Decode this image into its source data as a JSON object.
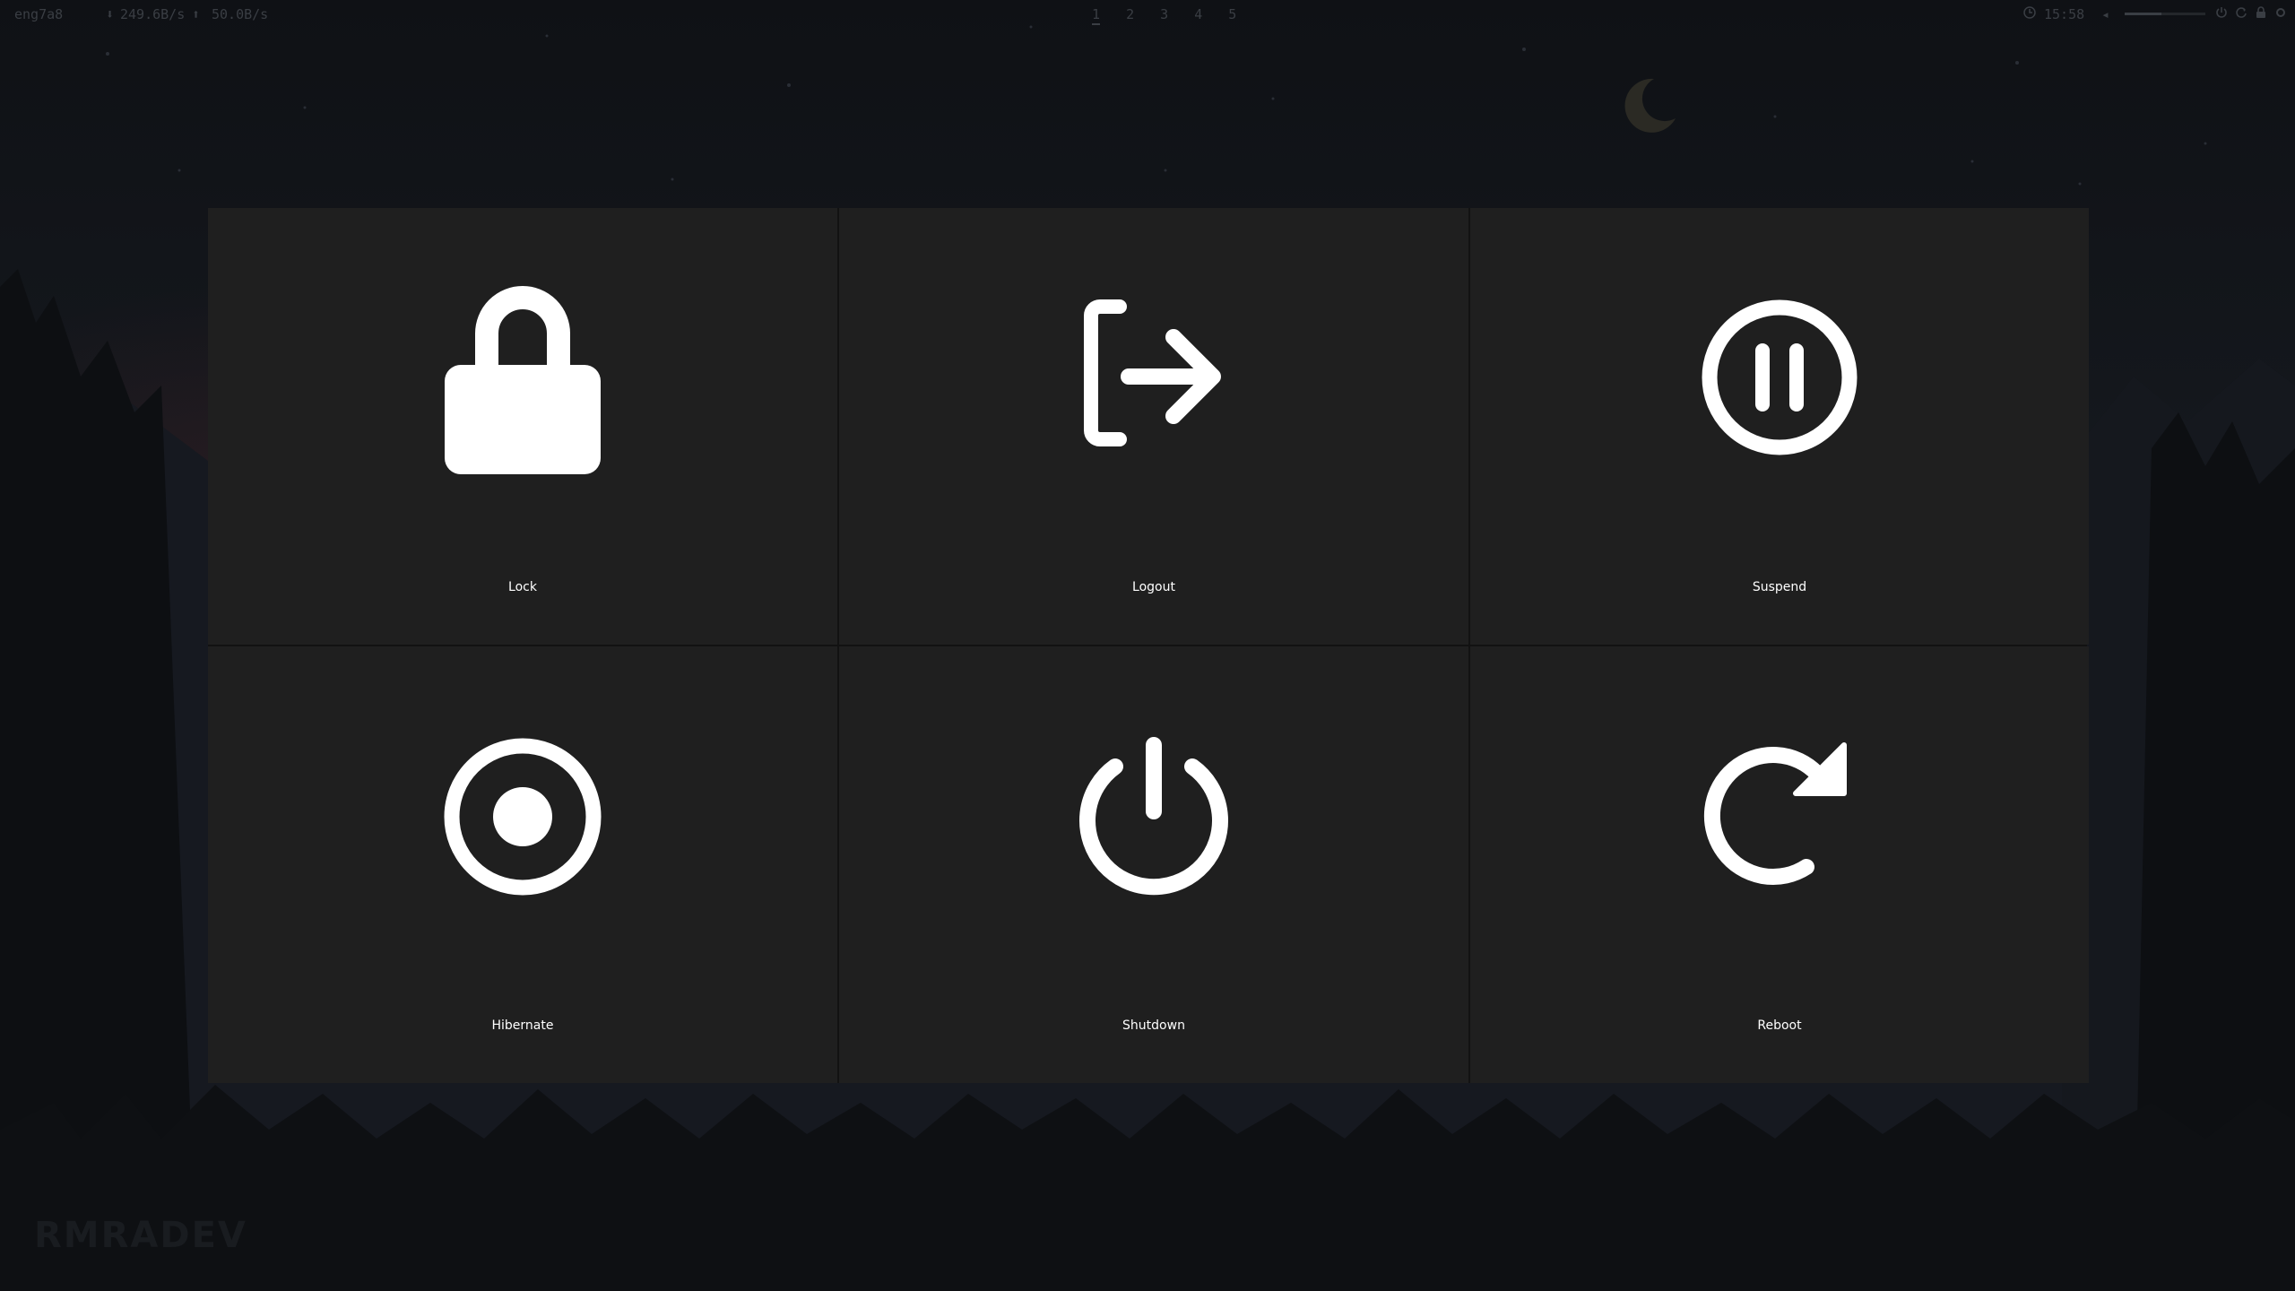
{
  "topbar": {
    "hostname": "eng7a8",
    "net_down": "249.6B/s",
    "net_up": "50.0B/s",
    "workspaces": [
      "1",
      "2",
      "3",
      "4",
      "5"
    ],
    "active_workspace": "1",
    "clock": "15:58",
    "volume_level": 0.45
  },
  "menu": {
    "tiles": [
      {
        "label": "Lock",
        "icon": "lock-icon"
      },
      {
        "label": "Logout",
        "icon": "logout-icon"
      },
      {
        "label": "Suspend",
        "icon": "suspend-icon"
      },
      {
        "label": "Hibernate",
        "icon": "hibernate-icon"
      },
      {
        "label": "Shutdown",
        "icon": "shutdown-icon"
      },
      {
        "label": "Reboot",
        "icon": "reboot-icon"
      }
    ]
  },
  "watermark": {
    "text": "RMRADEV"
  },
  "colors": {
    "tile_bg": "#1f1f1f",
    "menu_border": "#121212",
    "icon": "#ffffff",
    "label": "#ffffff",
    "sky_top": "#0f1115",
    "sky_mid": "#181c22",
    "bar_text": "#3a3e44"
  }
}
